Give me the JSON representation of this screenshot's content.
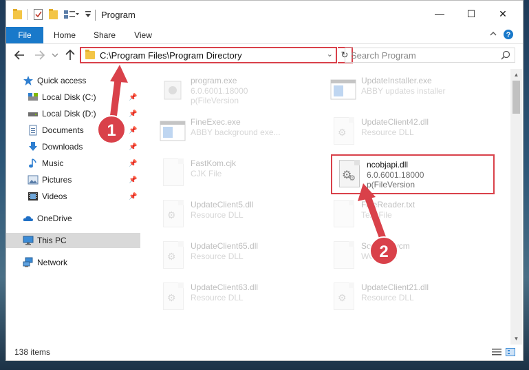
{
  "window": {
    "title": "Program",
    "controls": {
      "minimize": "—",
      "maximize": "☐",
      "close": "✕"
    }
  },
  "ribbon": {
    "tabs": [
      "File",
      "Home",
      "Share",
      "View"
    ]
  },
  "address": {
    "path": "C:\\Program Files\\Program Directory",
    "dropdown": "⌄",
    "refresh": "↻",
    "search_placeholder": "Search Program"
  },
  "sidebar": {
    "items": [
      {
        "label": "Quick access",
        "icon": "star-icon",
        "pinned": false
      },
      {
        "label": "Local Disk (C:)",
        "icon": "drive-icon",
        "pinned": true
      },
      {
        "label": "Local Disk (D:)",
        "icon": "drive-icon",
        "pinned": true
      },
      {
        "label": "Documents",
        "icon": "documents-icon",
        "pinned": true
      },
      {
        "label": "Downloads",
        "icon": "download-icon",
        "pinned": true
      },
      {
        "label": "Music",
        "icon": "music-icon",
        "pinned": true
      },
      {
        "label": "Pictures",
        "icon": "pictures-icon",
        "pinned": true
      },
      {
        "label": "Videos",
        "icon": "videos-icon",
        "pinned": true
      },
      {
        "label": "OneDrive",
        "icon": "cloud-icon",
        "pinned": false
      },
      {
        "label": "This PC",
        "icon": "computer-icon",
        "pinned": false
      },
      {
        "label": "Network",
        "icon": "network-icon",
        "pinned": false
      }
    ]
  },
  "files": [
    {
      "name": "program.exe",
      "line1": "6.0.6001.18000",
      "line2": "p(FileVersion",
      "icon": "exe-icon"
    },
    {
      "name": "UpdateInstaller.exe",
      "line1": "ABBY updates installer",
      "line2": "",
      "icon": "exe-window-icon"
    },
    {
      "name": "FineExec.exe",
      "line1": "ABBY background exe...",
      "line2": "",
      "icon": "exe-window-icon"
    },
    {
      "name": "UpdateClient42.dll",
      "line1": "Resource DLL",
      "line2": "",
      "icon": "dll-icon"
    },
    {
      "name": "FastKom.cjk",
      "line1": "CJK File",
      "line2": "",
      "icon": "blank-file-icon"
    },
    {
      "name": "ncobjapi.dll",
      "line1": "6.0.6001.18000",
      "line2": "p(FileVersion",
      "icon": "dll-icon"
    },
    {
      "name": "UpdateClient5.dll",
      "line1": "Resource DLL",
      "line2": "",
      "icon": "dll-icon"
    },
    {
      "name": "FineReader.txt",
      "line1": "Text File",
      "line2": "",
      "icon": "blank-file-icon"
    },
    {
      "name": "UpdateClient65.dll",
      "line1": "Resource DLL",
      "line2": "",
      "icon": "dll-icon"
    },
    {
      "name": "SoftP14.wcm",
      "line1": "WCM File",
      "line2": "",
      "icon": "blank-file-icon"
    },
    {
      "name": "UpdateClient63.dll",
      "line1": "Resource DLL",
      "line2": "",
      "icon": "dll-icon"
    },
    {
      "name": "UpdateClient21.dll",
      "line1": "Resource DLL",
      "line2": "",
      "icon": "dll-icon"
    }
  ],
  "status": {
    "item_count": "138 items"
  },
  "annotations": {
    "step1": "1",
    "step2": "2"
  },
  "colors": {
    "accent": "#1979ca",
    "highlight": "#d9414a"
  }
}
